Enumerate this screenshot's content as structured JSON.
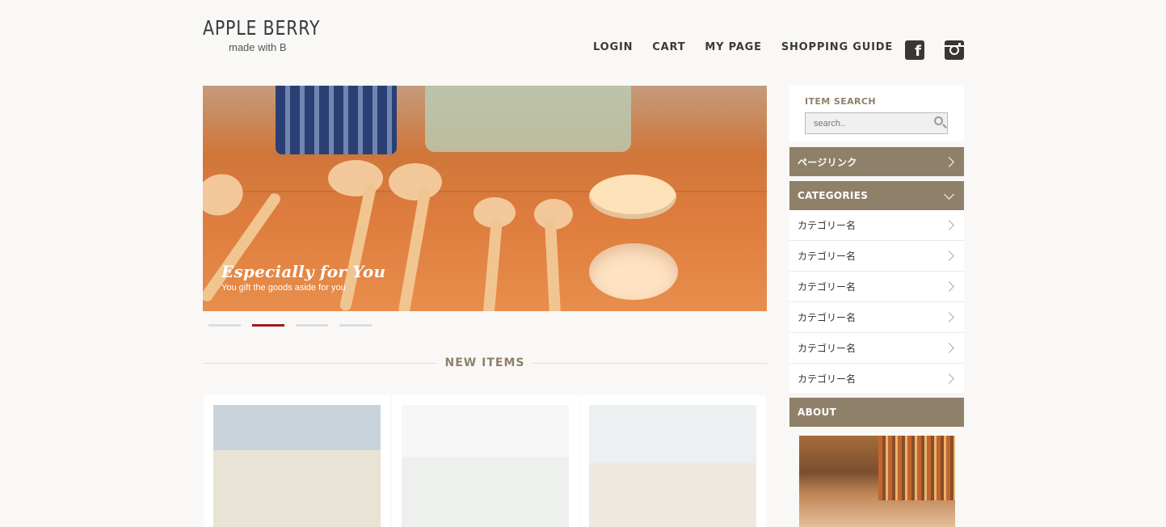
{
  "brand": {
    "name": "APPLE BERRY",
    "tagline": "made with B"
  },
  "nav": [
    "LOGIN",
    "CART",
    "MY PAGE",
    "SHOPPING GUIDE"
  ],
  "social": [
    "facebook-icon",
    "instagram-icon"
  ],
  "hero": {
    "title": "Especially for You",
    "subtitle": "You gift the goods aside for you",
    "slide_count": 4,
    "active_slide": 2
  },
  "section": {
    "new_items_title": "NEW ITEMS"
  },
  "products": [
    {
      "image": "plant-window-photo"
    },
    {
      "image": "birdcage-photo"
    },
    {
      "image": "living-room-photo"
    }
  ],
  "sidebar": {
    "search_title": "ITEM SEARCH",
    "search_placeholder": "search..",
    "page_link_label": "ページリンク",
    "categories_label": "CATEGORIES",
    "categories": [
      "カテゴリー名",
      "カテゴリー名",
      "カテゴリー名",
      "カテゴリー名",
      "カテゴリー名",
      "カテゴリー名"
    ],
    "about_label": "ABOUT"
  },
  "colors": {
    "accent": "#8f806a",
    "active_dot": "#9b1b1b",
    "background": "#f9f8f6"
  }
}
